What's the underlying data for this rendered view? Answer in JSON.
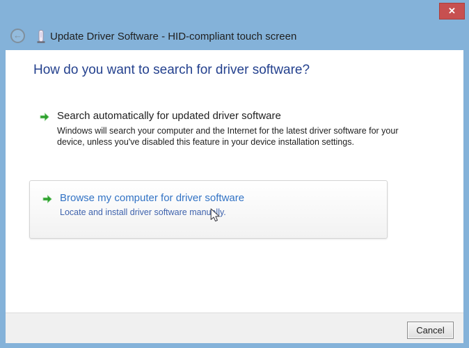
{
  "window": {
    "title": "Update Driver Software - HID-compliant touch screen"
  },
  "titlebar": {
    "close_icon": "✕",
    "back_icon": "←"
  },
  "content": {
    "heading": "How do you want to search for driver software?",
    "options": [
      {
        "title": "Search automatically for updated driver software",
        "description": "Windows will search your computer and the Internet for the latest driver software for your device, unless you've disabled this feature in your device installation settings.",
        "state": "normal"
      },
      {
        "title": "Browse my computer for driver software",
        "description": "Locate and install driver software manually.",
        "state": "hover"
      }
    ]
  },
  "footer": {
    "cancel_label": "Cancel"
  },
  "icons": {
    "titlebar_device": "driver-device-icon",
    "back": "back-arrow-icon",
    "close": "close-icon",
    "option_bullet": "green-arrow-icon",
    "pointer": "mouse-cursor"
  },
  "colors": {
    "titlebar_blue": "#84b2d9",
    "close_red": "#c75050",
    "heading_navy": "#24418e",
    "link_blue": "#3273c5",
    "link_blue_dim": "#3f63ad",
    "arrow_green": "#2ca02c",
    "footer_gray": "#f0f0f0",
    "content_white": "#ffffff"
  }
}
